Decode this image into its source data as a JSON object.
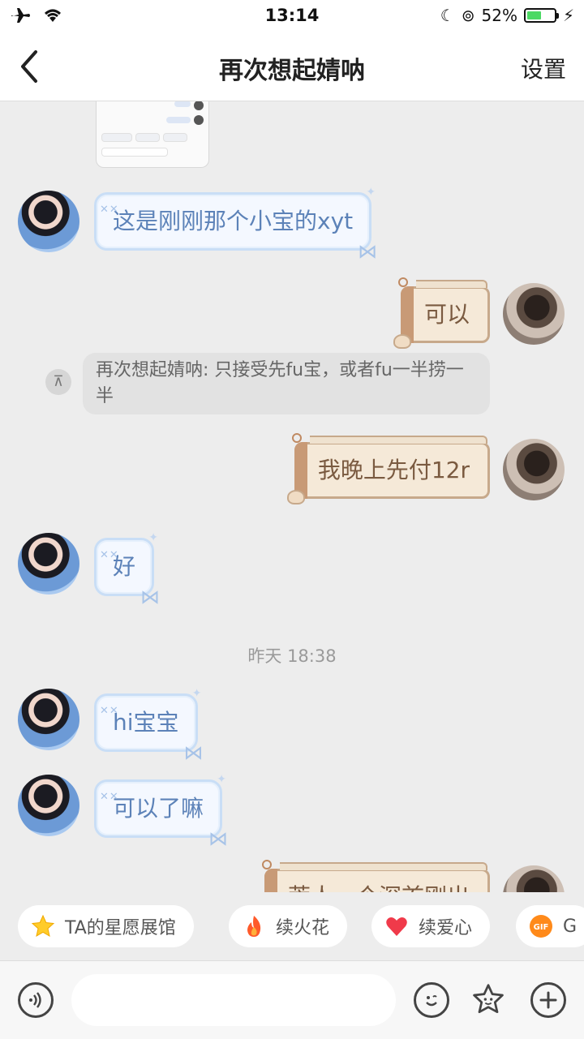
{
  "status_bar": {
    "time": "13:14",
    "battery_percent": "52%",
    "battery_level": 0.52
  },
  "nav": {
    "title": "再次想起婧呐",
    "settings_label": "设置"
  },
  "messages": {
    "m1": "这是刚刚那个小宝的xyt",
    "m2": "可以",
    "quote": "再次想起婧呐: 只接受先fu宝，或者fu一半捞一半",
    "m3": "我晚上先付12r",
    "m4": "好",
    "timestamp": "昨天 18:38",
    "m5": "hi宝宝",
    "m6": "可以了嘛",
    "m7": "荒人一个深首刚出"
  },
  "quick_actions": [
    {
      "label": "TA的星愿展馆",
      "icon": "star-icon"
    },
    {
      "label": "续火花",
      "icon": "flame-icon"
    },
    {
      "label": "续爱心",
      "icon": "heart-icon"
    },
    {
      "label": "G",
      "icon": "gif-icon"
    }
  ],
  "input": {
    "placeholder": ""
  },
  "colors": {
    "in_bubble_border": "#c9def6",
    "out_bubble_fill": "#f5e9d8",
    "battery": "#4cd964"
  }
}
